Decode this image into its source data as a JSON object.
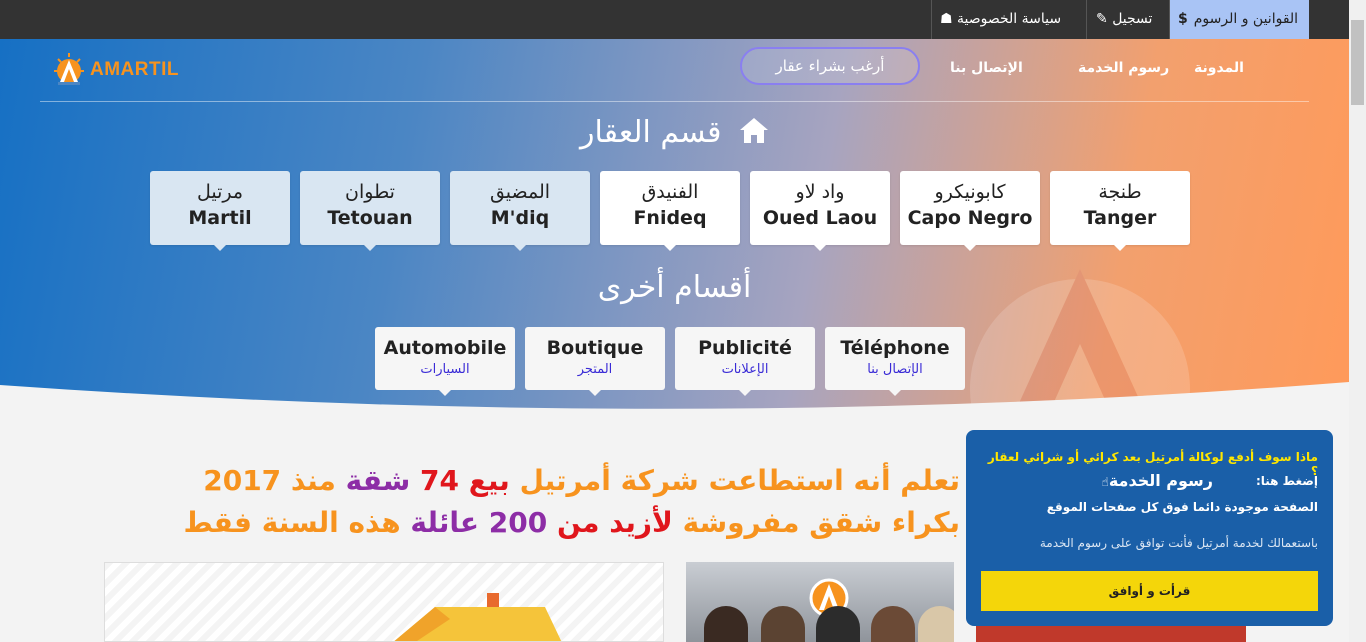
{
  "topbar": {
    "laws_label": "القوانين و الرسوم",
    "register_label": "تسجيل",
    "privacy_label": "سياسة الخصوصية"
  },
  "header": {
    "logo_text": "AMARTIL",
    "nav": {
      "blog": "المدونة",
      "fees": "رسوم الخدمة",
      "contact": "الإتصال بنا",
      "buy": "أرغب بشراء عقار"
    }
  },
  "realestate": {
    "title": "قسم العقار",
    "cities": [
      {
        "ar": "طنجة",
        "fr": "Tanger"
      },
      {
        "ar": "كابونيكرو",
        "fr": "Capo Negro"
      },
      {
        "ar": "واد لاو",
        "fr": "Oued Laou"
      },
      {
        "ar": "الفنيدق",
        "fr": "Fnideq"
      },
      {
        "ar": "المضيق",
        "fr": "M'diq"
      },
      {
        "ar": "تطوان",
        "fr": "Tetouan"
      },
      {
        "ar": "مرتيل",
        "fr": "Martil"
      }
    ]
  },
  "others": {
    "title": "أقسام أخرى",
    "items": [
      {
        "fr": "Téléphone",
        "ar": "الإتصال بنا"
      },
      {
        "fr": "Publicité",
        "ar": "الإعلانات"
      },
      {
        "fr": "Boutique",
        "ar": "المتجر"
      },
      {
        "fr": "Automobile",
        "ar": "السيارات"
      }
    ]
  },
  "headline": {
    "l1_a": "تعلم أنه استطاعت شركة أمرتيل",
    "l1_b": "بيع",
    "l1_c": "74",
    "l1_d": "شقة",
    "l1_e": "منذ 2017",
    "l2_a": "بكراء شقق مفروشة",
    "l2_b": "لأزيد من",
    "l2_c": "200",
    "l2_d": "عائلة",
    "l2_e": "هذه السنة فقط"
  },
  "popup": {
    "question": "ماذا سوف أدفع لوكالة أمرتيل بعد كرائي أو شرائي لعقار ؟",
    "press": "إضغط هنا:",
    "fees_link": "رسوم الخدمة",
    "always": "الصفحة موجودة دائما فوق كل صفحات الموقع",
    "agree_note": "باستعمالك لخدمة أمرتيل فأنت توافق على رسوم الخدمة",
    "accept": "قرأت و أوافق"
  },
  "colors": {
    "accent_orange": "#f7931e",
    "accent_red": "#e0161c",
    "accent_purple": "#8d2da6",
    "popup_bg": "#1a5fa8",
    "accept_bg": "#f4d60a"
  }
}
